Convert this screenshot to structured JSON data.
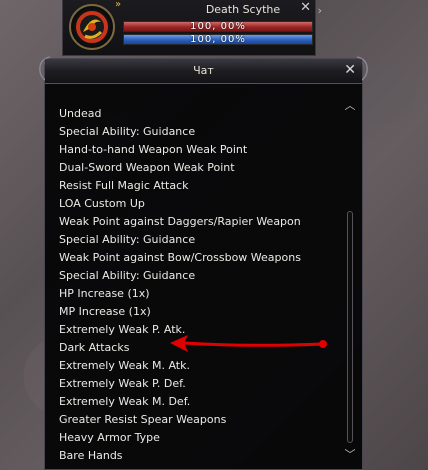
{
  "target": {
    "name": "Death Scythe",
    "hp_text": "100, 00%",
    "hp_fraction": 1.0,
    "mp_text": "100, 00%",
    "mp_fraction": 1.0,
    "close_symbol": "✕",
    "arrow_symbol": "›",
    "menu_symbol": "»"
  },
  "chat": {
    "title": "Чат",
    "close_symbol": "✕",
    "scroll_up_symbol": "︿",
    "scroll_down_symbol": "﹀",
    "lines": [
      "Undead",
      "Special Ability: Guidance",
      "Hand-to-hand Weapon Weak Point",
      "Dual-Sword Weapon Weak Point",
      "Resist Full Magic Attack",
      "LOA Custom Up",
      "Weak Point against Daggers/Rapier Weapon",
      "Special Ability: Guidance",
      "Weak Point against Bow/Crossbow Weapons",
      "Special Ability: Guidance",
      "HP Increase (1x)",
      "MP Increase (1x)",
      "Extremely Weak P. Atk.",
      "Dark Attacks",
      "Extremely Weak M. Atk.",
      "Extremely Weak P. Def.",
      "Extremely Weak M. Def.",
      "Greater Resist Spear Weapons",
      "Heavy Armor Type",
      "Bare Hands"
    ]
  },
  "colors": {
    "hp": "#9c2626",
    "mp": "#2a5fbf",
    "annotation_arrow": "#e00000"
  }
}
